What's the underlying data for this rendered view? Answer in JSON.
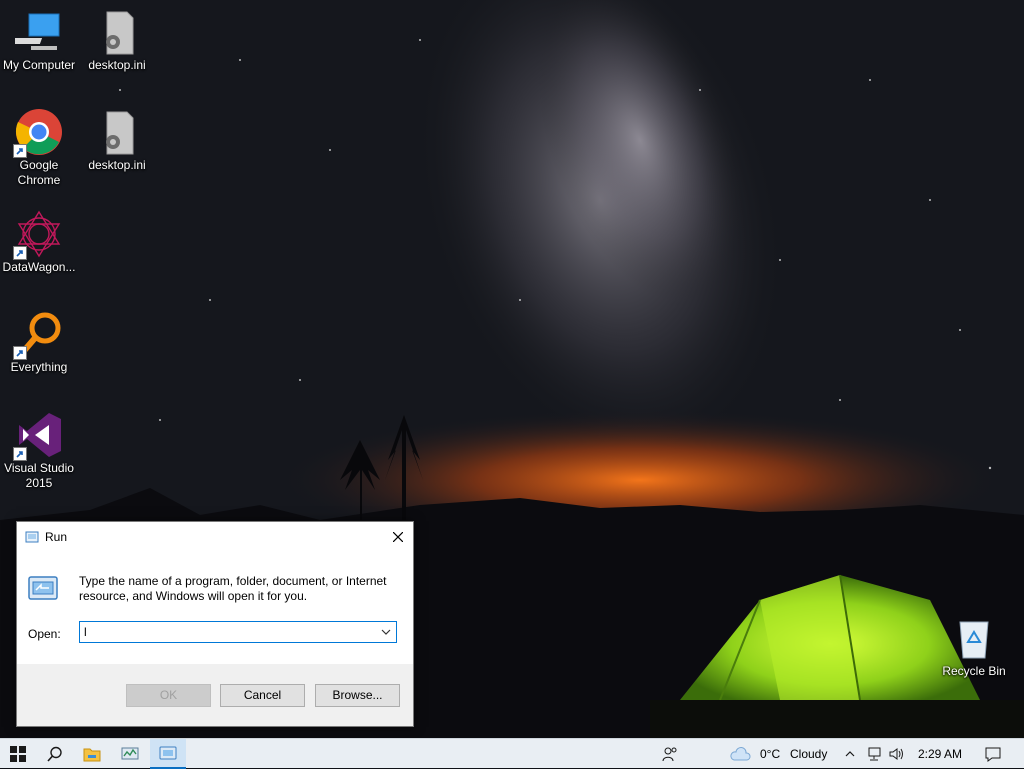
{
  "desktop": {
    "icons": [
      {
        "label": "My Computer",
        "icon": "computer-icon"
      },
      {
        "label": "desktop.ini",
        "icon": "settings-file-icon"
      },
      {
        "label": "Google Chrome",
        "icon": "chrome-icon"
      },
      {
        "label": "desktop.ini",
        "icon": "settings-file-icon"
      },
      {
        "label": "DataWagon...",
        "icon": "datawagon-icon"
      },
      {
        "label": "Everything",
        "icon": "magnifier-icon"
      },
      {
        "label": "Visual Studio 2015",
        "icon": "visual-studio-icon"
      },
      {
        "label": "Recycle Bin",
        "icon": "recycle-bin-icon"
      }
    ]
  },
  "run_dialog": {
    "title": "Run",
    "description": "Type the name of a program, folder, document, or Internet resource, and Windows will open it for you.",
    "open_label": "Open:",
    "open_value": "l",
    "ok_label": "OK",
    "cancel_label": "Cancel",
    "browse_label": "Browse..."
  },
  "taskbar": {
    "weather_temp": "0°C",
    "weather_text": "Cloudy",
    "clock": "2:29 AM",
    "accent_color": "#0a6fc2"
  }
}
